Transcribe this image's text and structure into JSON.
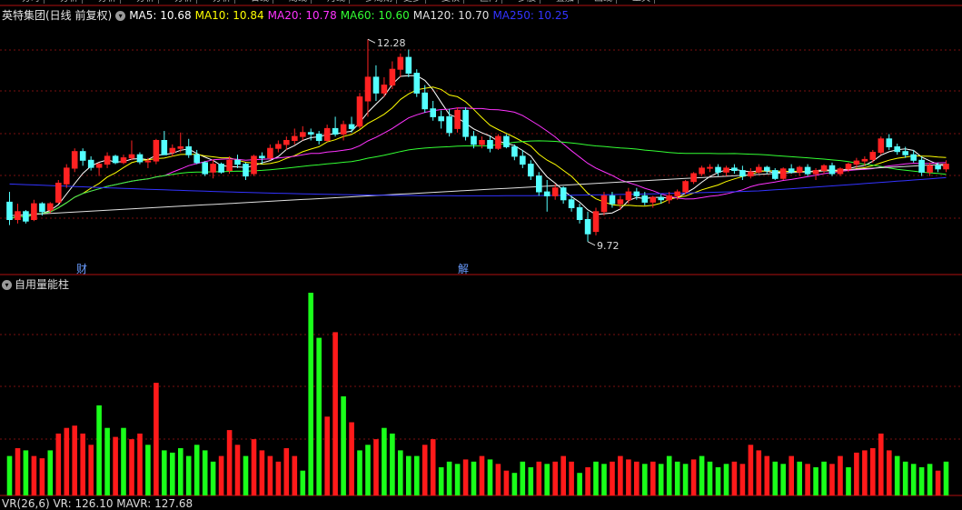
{
  "top_bar": {
    "buttons": [
      "分时",
      "分析",
      "分析",
      "分析",
      "分析",
      "分析",
      "日线",
      "周线",
      "月线",
      "多周期",
      "更多",
      "复权",
      "区间",
      "多股",
      "叠加",
      "画线",
      "工具"
    ]
  },
  "header": {
    "title": "英特集团(日线 前复权)",
    "ma_values": [
      {
        "label": "MA5: 10.68",
        "color": "#ffffff"
      },
      {
        "label": "MA10: 10.84",
        "color": "#ffff00"
      },
      {
        "label": "MA20: 10.78",
        "color": "#ff33ff"
      },
      {
        "label": "MA60: 10.60",
        "color": "#33ff33"
      },
      {
        "label": "MA120: 10.70",
        "color": "#e0e0e0"
      },
      {
        "label": "MA250: 10.25",
        "color": "#3333ff"
      }
    ]
  },
  "price_labels": {
    "high": "12.28",
    "low": "9.72"
  },
  "markers": [
    "财",
    "解"
  ],
  "indicator": {
    "title": "自用量能柱",
    "bottom_text": "VR(26,6) VR: 126.10 MAVR: 127.68"
  },
  "colors": {
    "up": "#ff2222",
    "down": "#54ffff",
    "vol_up": "#ff1a1a",
    "vol_down": "#1aff1a",
    "grid": "#7a1010"
  },
  "chart_data": [
    {
      "type": "candlestick",
      "title": "英特集团(日线 前复权)",
      "ylim": [
        9.5,
        12.5
      ],
      "ohlc": [
        [
          10.22,
          10.35,
          9.93,
          10.0
        ],
        [
          10.0,
          10.2,
          9.95,
          10.1
        ],
        [
          10.1,
          10.12,
          9.95,
          9.98
        ],
        [
          10.0,
          10.25,
          9.98,
          10.2
        ],
        [
          10.2,
          10.22,
          10.05,
          10.1
        ],
        [
          10.12,
          10.22,
          10.08,
          10.2
        ],
        [
          10.22,
          10.5,
          10.2,
          10.46
        ],
        [
          10.45,
          10.7,
          10.4,
          10.65
        ],
        [
          10.65,
          10.9,
          10.6,
          10.86
        ],
        [
          10.86,
          10.9,
          10.68,
          10.75
        ],
        [
          10.75,
          10.8,
          10.62,
          10.66
        ],
        [
          10.66,
          10.72,
          10.55,
          10.7
        ],
        [
          10.7,
          10.85,
          10.65,
          10.8
        ],
        [
          10.8,
          10.82,
          10.7,
          10.72
        ],
        [
          10.72,
          10.82,
          10.7,
          10.78
        ],
        [
          10.78,
          11.0,
          10.75,
          10.82
        ],
        [
          10.82,
          10.85,
          10.7,
          10.73
        ],
        [
          10.73,
          10.78,
          10.65,
          10.74
        ],
        [
          10.74,
          11.02,
          10.7,
          11.0
        ],
        [
          11.0,
          11.12,
          10.95,
          10.82
        ],
        [
          10.85,
          10.95,
          10.8,
          10.9
        ],
        [
          10.9,
          11.1,
          10.85,
          10.92
        ],
        [
          10.92,
          11.02,
          10.78,
          10.82
        ],
        [
          10.82,
          10.88,
          10.7,
          10.72
        ],
        [
          10.72,
          10.74,
          10.55,
          10.58
        ],
        [
          10.6,
          10.76,
          10.52,
          10.7
        ],
        [
          10.7,
          10.72,
          10.58,
          10.6
        ],
        [
          10.62,
          10.8,
          10.58,
          10.75
        ],
        [
          10.75,
          10.82,
          10.65,
          10.7
        ],
        [
          10.7,
          10.72,
          10.5,
          10.55
        ],
        [
          10.58,
          10.82,
          10.55,
          10.8
        ],
        [
          10.8,
          10.85,
          10.7,
          10.78
        ],
        [
          10.78,
          10.95,
          10.75,
          10.9
        ],
        [
          10.9,
          11.0,
          10.85,
          10.95
        ],
        [
          10.95,
          11.05,
          10.88,
          11.0
        ],
        [
          11.0,
          11.15,
          10.95,
          11.05
        ],
        [
          11.05,
          11.18,
          11.0,
          11.1
        ],
        [
          11.1,
          11.15,
          11.0,
          11.08
        ],
        [
          11.08,
          11.12,
          10.95,
          11.0
        ],
        [
          11.0,
          11.2,
          10.98,
          11.15
        ],
        [
          11.15,
          11.3,
          11.05,
          11.08
        ],
        [
          11.08,
          11.25,
          11.0,
          11.2
        ],
        [
          11.2,
          11.3,
          11.1,
          11.15
        ],
        [
          11.18,
          11.6,
          11.15,
          11.55
        ],
        [
          11.5,
          12.28,
          11.3,
          11.8
        ],
        [
          11.8,
          11.95,
          11.5,
          11.6
        ],
        [
          11.6,
          11.8,
          11.55,
          11.7
        ],
        [
          11.7,
          12.0,
          11.65,
          11.9
        ],
        [
          11.9,
          12.1,
          11.8,
          12.05
        ],
        [
          12.05,
          12.15,
          11.8,
          11.85
        ],
        [
          11.85,
          11.9,
          11.55,
          11.6
        ],
        [
          11.6,
          11.7,
          11.35,
          11.4
        ],
        [
          11.4,
          11.5,
          11.25,
          11.3
        ],
        [
          11.3,
          11.38,
          11.15,
          11.25
        ],
        [
          11.3,
          11.4,
          11.05,
          11.1
        ],
        [
          11.15,
          11.42,
          11.1,
          11.38
        ],
        [
          11.38,
          11.42,
          11.0,
          11.05
        ],
        [
          11.05,
          11.12,
          10.9,
          10.95
        ],
        [
          10.95,
          11.05,
          10.9,
          11.0
        ],
        [
          11.0,
          11.05,
          10.85,
          10.9
        ],
        [
          10.9,
          11.08,
          10.88,
          11.05
        ],
        [
          11.05,
          11.08,
          10.9,
          10.92
        ],
        [
          10.92,
          10.95,
          10.75,
          10.8
        ],
        [
          10.8,
          10.88,
          10.65,
          10.7
        ],
        [
          10.7,
          10.75,
          10.5,
          10.55
        ],
        [
          10.55,
          10.6,
          10.3,
          10.35
        ],
        [
          10.35,
          10.5,
          10.1,
          10.3
        ],
        [
          10.3,
          10.45,
          10.25,
          10.4
        ],
        [
          10.4,
          10.42,
          10.2,
          10.25
        ],
        [
          10.25,
          10.3,
          10.1,
          10.15
        ],
        [
          10.15,
          10.2,
          9.95,
          10.0
        ],
        [
          10.0,
          10.1,
          9.72,
          9.82
        ],
        [
          9.85,
          10.15,
          9.8,
          10.1
        ],
        [
          10.1,
          10.35,
          10.05,
          10.3
        ],
        [
          10.3,
          10.35,
          10.15,
          10.2
        ],
        [
          10.2,
          10.3,
          10.12,
          10.25
        ],
        [
          10.25,
          10.4,
          10.2,
          10.35
        ],
        [
          10.35,
          10.4,
          10.25,
          10.3
        ],
        [
          10.3,
          10.35,
          10.18,
          10.22
        ],
        [
          10.22,
          10.3,
          10.15,
          10.28
        ],
        [
          10.28,
          10.32,
          10.2,
          10.25
        ],
        [
          10.25,
          10.35,
          10.2,
          10.3
        ],
        [
          10.3,
          10.38,
          10.25,
          10.35
        ],
        [
          10.35,
          10.5,
          10.32,
          10.48
        ],
        [
          10.48,
          10.6,
          10.45,
          10.58
        ],
        [
          10.58,
          10.68,
          10.55,
          10.65
        ],
        [
          10.65,
          10.7,
          10.6,
          10.66
        ],
        [
          10.66,
          10.7,
          10.55,
          10.6
        ],
        [
          10.6,
          10.68,
          10.55,
          10.65
        ],
        [
          10.65,
          10.7,
          10.58,
          10.62
        ],
        [
          10.62,
          10.68,
          10.5,
          10.55
        ],
        [
          10.55,
          10.65,
          10.52,
          10.6
        ],
        [
          10.6,
          10.7,
          10.58,
          10.66
        ],
        [
          10.66,
          10.68,
          10.58,
          10.62
        ],
        [
          10.62,
          10.65,
          10.5,
          10.52
        ],
        [
          10.52,
          10.66,
          10.5,
          10.64
        ],
        [
          10.64,
          10.7,
          10.58,
          10.6
        ],
        [
          10.6,
          10.68,
          10.55,
          10.66
        ],
        [
          10.66,
          10.7,
          10.55,
          10.58
        ],
        [
          10.58,
          10.65,
          10.5,
          10.62
        ],
        [
          10.62,
          10.7,
          10.58,
          10.68
        ],
        [
          10.68,
          10.72,
          10.55,
          10.58
        ],
        [
          10.58,
          10.66,
          10.55,
          10.64
        ],
        [
          10.64,
          10.72,
          10.6,
          10.7
        ],
        [
          10.7,
          10.78,
          10.65,
          10.74
        ],
        [
          10.74,
          10.8,
          10.68,
          10.76
        ],
        [
          10.76,
          10.88,
          10.72,
          10.85
        ],
        [
          10.85,
          11.05,
          10.82,
          11.02
        ],
        [
          11.02,
          11.08,
          10.88,
          10.92
        ],
        [
          10.92,
          10.96,
          10.82,
          10.86
        ],
        [
          10.86,
          10.92,
          10.78,
          10.82
        ],
        [
          10.82,
          10.88,
          10.72,
          10.75
        ],
        [
          10.75,
          10.8,
          10.55,
          10.6
        ],
        [
          10.6,
          10.72,
          10.55,
          10.68
        ],
        [
          10.68,
          10.72,
          10.6,
          10.64
        ],
        [
          10.64,
          10.75,
          10.6,
          10.7
        ]
      ],
      "volume": [
        [
          35,
          "down"
        ],
        [
          42,
          "up"
        ],
        [
          40,
          "down"
        ],
        [
          35,
          "up"
        ],
        [
          33,
          "up"
        ],
        [
          40,
          "down"
        ],
        [
          55,
          "up"
        ],
        [
          60,
          "up"
        ],
        [
          62,
          "up"
        ],
        [
          55,
          "up"
        ],
        [
          45,
          "up"
        ],
        [
          80,
          "down"
        ],
        [
          60,
          "down"
        ],
        [
          52,
          "up"
        ],
        [
          60,
          "down"
        ],
        [
          50,
          "up"
        ],
        [
          55,
          "up"
        ],
        [
          45,
          "down"
        ],
        [
          100,
          "up"
        ],
        [
          40,
          "down"
        ],
        [
          38,
          "down"
        ],
        [
          42,
          "down"
        ],
        [
          35,
          "down"
        ],
        [
          45,
          "down"
        ],
        [
          40,
          "down"
        ],
        [
          30,
          "down"
        ],
        [
          35,
          "up"
        ],
        [
          58,
          "up"
        ],
        [
          45,
          "up"
        ],
        [
          35,
          "down"
        ],
        [
          50,
          "up"
        ],
        [
          40,
          "up"
        ],
        [
          35,
          "up"
        ],
        [
          30,
          "up"
        ],
        [
          42,
          "up"
        ],
        [
          35,
          "up"
        ],
        [
          22,
          "down"
        ],
        [
          180,
          "down"
        ],
        [
          140,
          "down"
        ],
        [
          70,
          "up"
        ],
        [
          145,
          "up"
        ],
        [
          88,
          "down"
        ],
        [
          65,
          "up"
        ],
        [
          40,
          "down"
        ],
        [
          45,
          "down"
        ],
        [
          50,
          "up"
        ],
        [
          60,
          "down"
        ],
        [
          55,
          "down"
        ],
        [
          40,
          "down"
        ],
        [
          35,
          "down"
        ],
        [
          35,
          "down"
        ],
        [
          45,
          "up"
        ],
        [
          50,
          "up"
        ],
        [
          25,
          "down"
        ],
        [
          30,
          "down"
        ],
        [
          28,
          "down"
        ],
        [
          32,
          "up"
        ],
        [
          30,
          "down"
        ],
        [
          35,
          "up"
        ],
        [
          32,
          "down"
        ],
        [
          28,
          "up"
        ],
        [
          22,
          "up"
        ],
        [
          20,
          "down"
        ],
        [
          30,
          "down"
        ],
        [
          25,
          "down"
        ],
        [
          30,
          "up"
        ],
        [
          28,
          "down"
        ],
        [
          30,
          "up"
        ],
        [
          35,
          "up"
        ],
        [
          30,
          "up"
        ],
        [
          20,
          "down"
        ],
        [
          25,
          "up"
        ],
        [
          30,
          "down"
        ],
        [
          28,
          "down"
        ],
        [
          30,
          "up"
        ],
        [
          35,
          "up"
        ],
        [
          32,
          "up"
        ],
        [
          30,
          "up"
        ],
        [
          28,
          "down"
        ],
        [
          30,
          "up"
        ],
        [
          28,
          "down"
        ],
        [
          35,
          "down"
        ],
        [
          30,
          "down"
        ],
        [
          28,
          "down"
        ],
        [
          32,
          "up"
        ],
        [
          35,
          "down"
        ],
        [
          30,
          "down"
        ],
        [
          25,
          "down"
        ],
        [
          28,
          "down"
        ],
        [
          30,
          "up"
        ],
        [
          28,
          "up"
        ],
        [
          45,
          "up"
        ],
        [
          40,
          "up"
        ],
        [
          35,
          "up"
        ],
        [
          30,
          "down"
        ],
        [
          28,
          "down"
        ],
        [
          35,
          "up"
        ],
        [
          30,
          "down"
        ],
        [
          28,
          "up"
        ],
        [
          25,
          "down"
        ],
        [
          30,
          "down"
        ],
        [
          28,
          "up"
        ],
        [
          35,
          "up"
        ],
        [
          25,
          "down"
        ],
        [
          38,
          "up"
        ],
        [
          40,
          "up"
        ],
        [
          42,
          "up"
        ],
        [
          55,
          "up"
        ],
        [
          40,
          "up"
        ],
        [
          35,
          "down"
        ],
        [
          30,
          "down"
        ],
        [
          28,
          "down"
        ],
        [
          25,
          "down"
        ],
        [
          28,
          "down"
        ],
        [
          22,
          "up"
        ],
        [
          30,
          "down"
        ]
      ]
    }
  ]
}
